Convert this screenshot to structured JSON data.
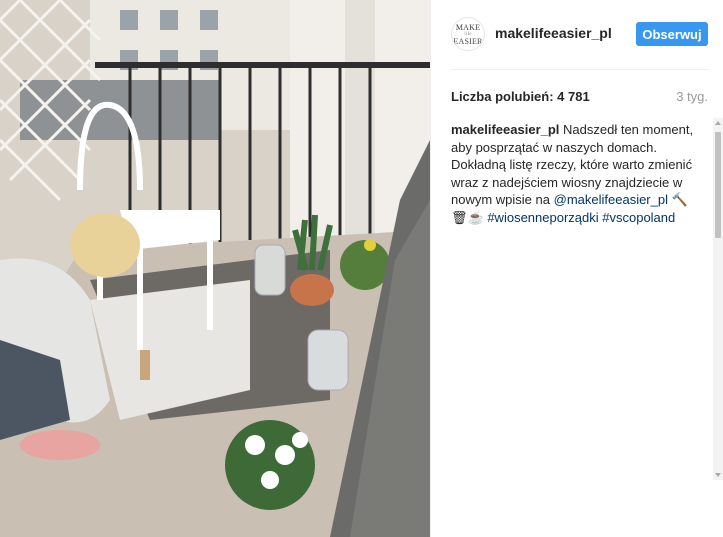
{
  "post": {
    "photo_alt": "Woman painting on a balcony with plants"
  },
  "header": {
    "avatar_top": "MAKE",
    "avatar_mid": "life",
    "avatar_bottom": "EASIER",
    "username": "makelifeeasier_pl",
    "follow_label": "Obserwuj"
  },
  "stats": {
    "likes": "Liczba polubień: 4 781",
    "time": "3 tyg."
  },
  "caption": {
    "author": "makelifeeasier_pl",
    "text": "Nadszedł ten moment, aby posprzątać w naszych domach. Dokładną listę rzeczy, które warto zmienić wraz z nadejściem wiosny znajdziecie w nowym wpisie na",
    "mention": "@makelifeeasier_pl",
    "emoji": "🔨🗑☕",
    "hashtag1": "#wiosenneporządki",
    "hashtag2": "#vscopoland"
  },
  "colors": {
    "follow_button": "#3897f0",
    "link": "#003569"
  }
}
